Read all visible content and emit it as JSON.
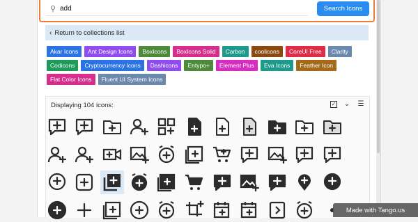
{
  "search": {
    "value": "add",
    "button_label": "Search Icons",
    "icon": "search-icon"
  },
  "nav": {
    "return_label": "Return to collections list",
    "chevron_icon": "chevron-left-icon"
  },
  "collections": [
    {
      "label": "Akar Icons",
      "color": "#2b73e4"
    },
    {
      "label": "Ant Design Icons",
      "color": "#8f4df0"
    },
    {
      "label": "BoxIcons",
      "color": "#4d8a3a"
    },
    {
      "label": "BoxIcons Solid",
      "color": "#d62e8d"
    },
    {
      "label": "Carbon",
      "color": "#1e9a8a"
    },
    {
      "label": "coolicons",
      "color": "#8a4a0f"
    },
    {
      "label": "CoreUI Free",
      "color": "#e02d47"
    },
    {
      "label": "Clarity",
      "color": "#6b88ad"
    },
    {
      "label": "Codicons",
      "color": "#1e9a5a"
    },
    {
      "label": "Cryptocurrency Icons",
      "color": "#2b73e4"
    },
    {
      "label": "Dashicons",
      "color": "#8f4df0"
    },
    {
      "label": "Entypo+",
      "color": "#4d8a3a"
    },
    {
      "label": "Element Plus",
      "color": "#d42dbf"
    },
    {
      "label": "Eva Icons",
      "color": "#1e9a8a"
    },
    {
      "label": "Feather Icon",
      "color": "#a5691a"
    },
    {
      "label": "Flat Color Icons",
      "color": "#d62e8d"
    },
    {
      "label": "Fluent UI System Icons",
      "color": "#6b88ad"
    }
  ],
  "icons_panel": {
    "count_text": "Displaying 104 icons:",
    "toolbar": [
      {
        "name": "select-all-checkbox",
        "glyph": "✓"
      },
      {
        "name": "expand-icon",
        "glyph": "⌄"
      },
      {
        "name": "menu-icon",
        "glyph": "☰"
      }
    ]
  },
  "icon_rows": [
    [
      "comment-add-icon",
      "chat-add-icon",
      "folder-add-icon",
      "user-add-icon",
      "grid-add-icon",
      "file-add-icon",
      "file-add-outline-icon",
      "file-add-gray-icon",
      "folder-add-solid-icon",
      "folder-add-outline-icon",
      "folder-add-gray-icon"
    ],
    [
      "user-add-icon",
      "users-add-icon",
      "video-add-icon",
      "image-add-icon",
      "alarm-add-icon",
      "library-add-icon",
      "cart-add-icon",
      "comment-add-icon",
      "photo-add-icon",
      "comment-add-outline-icon",
      "comment-add-icon"
    ],
    [
      "message-add-icon",
      "square-add-icon",
      "queue-add-selected-icon",
      "alarm-add-solid-icon",
      "book-add-icon",
      "cart-add-solid-icon",
      "comment-add-solid-icon",
      "image-add-solid-icon",
      "comment-add-solid-icon",
      "location-add-icon",
      "message-add-solid-icon"
    ],
    [
      "circle-add-solid-icon",
      "plus-icon",
      "library-add-icon",
      "circle-add-icon",
      "alarm-add-icon",
      "crop-add-icon",
      "calendar-add-icon",
      "calendar-add-outline-icon",
      "slide-add-icon",
      "alarm-add-outline-icon",
      "more-icon"
    ]
  ],
  "selected_icon": "queue-add-selected-icon",
  "watermark": "Made with Tango.us"
}
